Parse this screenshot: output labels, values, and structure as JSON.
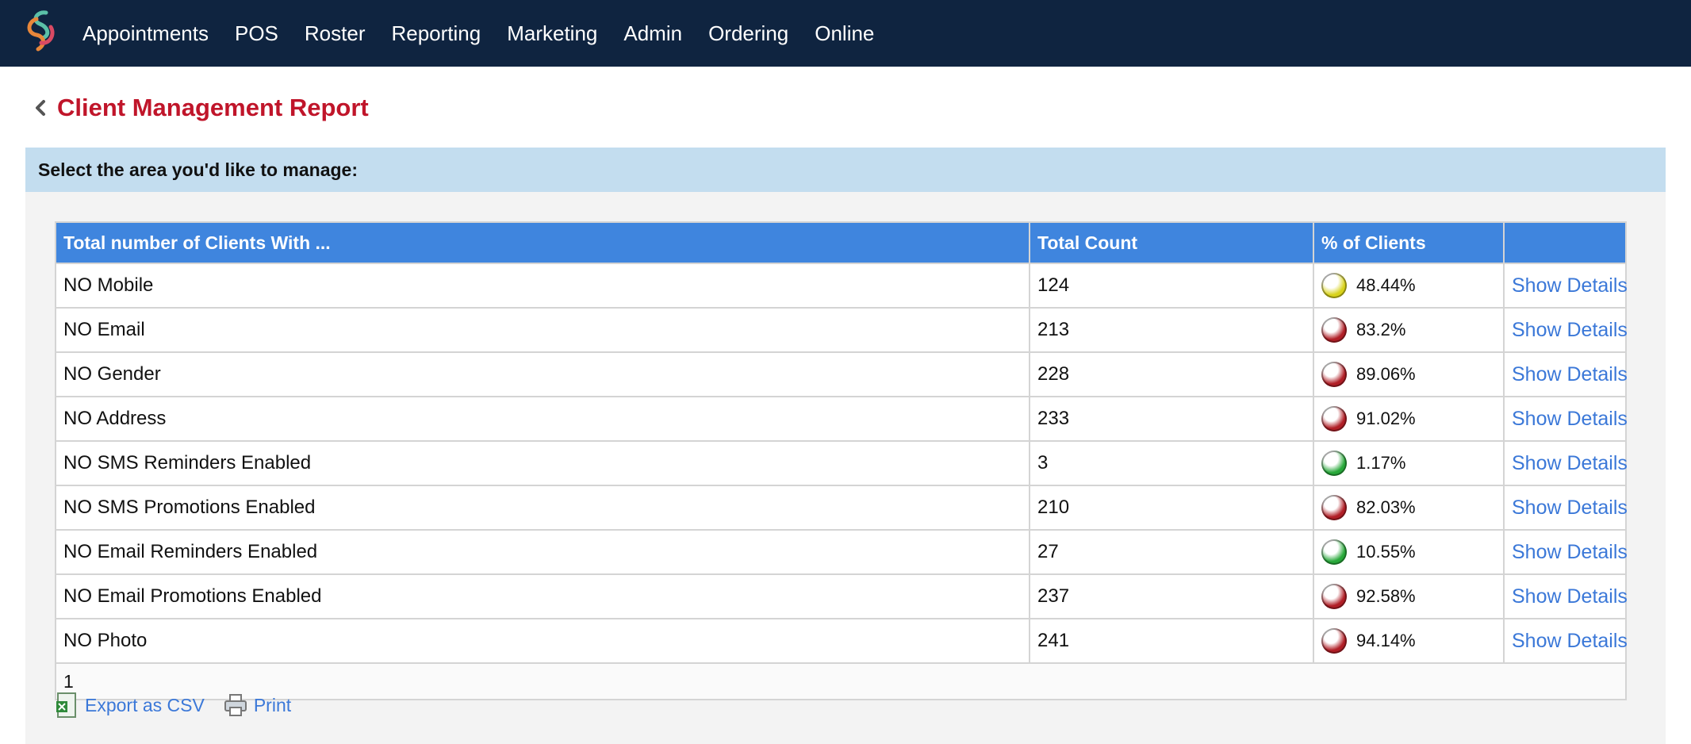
{
  "nav": {
    "items": [
      "Appointments",
      "POS",
      "Roster",
      "Reporting",
      "Marketing",
      "Admin",
      "Ordering",
      "Online"
    ]
  },
  "page": {
    "title": "Client Management Report",
    "prompt": "Select the area you'd like to manage:"
  },
  "table": {
    "headers": [
      "Total number of Clients With ...",
      "Total Count",
      "% of Clients",
      ""
    ],
    "rows": [
      {
        "label": "NO Mobile",
        "count": "124",
        "percent": "48.44%",
        "status": "yellow",
        "action": "Show Details"
      },
      {
        "label": "NO Email",
        "count": "213",
        "percent": "83.2%",
        "status": "red",
        "action": "Show Details"
      },
      {
        "label": "NO Gender",
        "count": "228",
        "percent": "89.06%",
        "status": "red",
        "action": "Show Details"
      },
      {
        "label": "NO Address",
        "count": "233",
        "percent": "91.02%",
        "status": "red",
        "action": "Show Details"
      },
      {
        "label": "NO SMS Reminders Enabled",
        "count": "3",
        "percent": "1.17%",
        "status": "green",
        "action": "Show Details"
      },
      {
        "label": "NO SMS Promotions Enabled",
        "count": "210",
        "percent": "82.03%",
        "status": "red",
        "action": "Show Details"
      },
      {
        "label": "NO Email Reminders Enabled",
        "count": "27",
        "percent": "10.55%",
        "status": "green",
        "action": "Show Details"
      },
      {
        "label": "NO Email Promotions Enabled",
        "count": "237",
        "percent": "92.58%",
        "status": "red",
        "action": "Show Details"
      },
      {
        "label": "NO Photo",
        "count": "241",
        "percent": "94.14%",
        "status": "red",
        "action": "Show Details"
      }
    ],
    "pager": "1"
  },
  "toolbar": {
    "export_label": "Export as CSV",
    "print_label": "Print",
    "export_icon": "csv-export-icon",
    "print_icon": "printer-icon"
  },
  "colors": {
    "topbar": "#0f2440",
    "title": "#c0152a",
    "header": "#3f85de",
    "link": "#3b78d8",
    "status_red": "#b01e26",
    "status_yellow": "#d8d21a",
    "status_green": "#28a83a"
  }
}
